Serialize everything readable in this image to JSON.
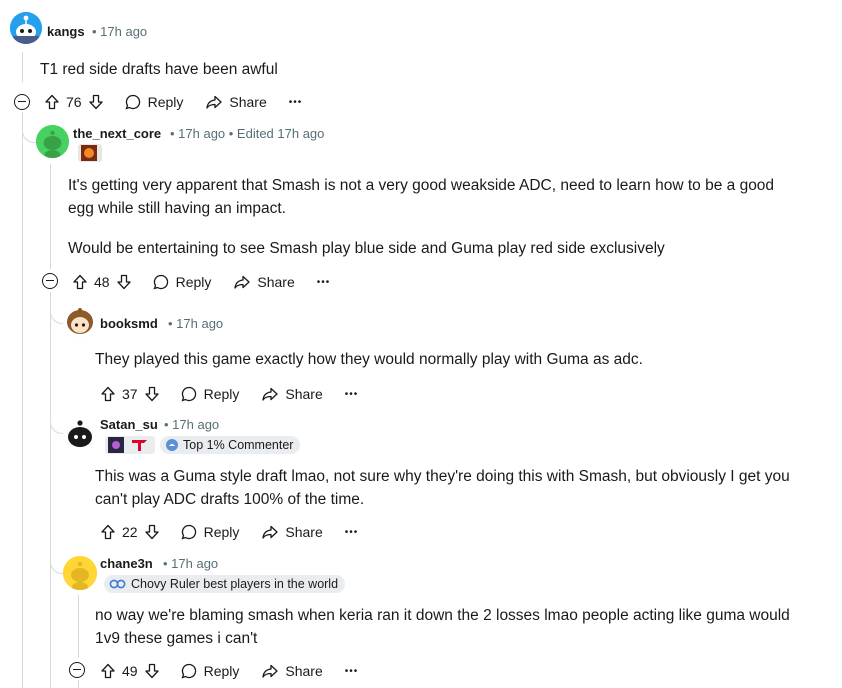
{
  "comments": [
    {
      "user": "kangs",
      "time": "• 17h ago",
      "body": [
        "T1 red side drafts have been awful"
      ],
      "votes": "76"
    },
    {
      "user": "the_next_core",
      "time": "• 17h ago • Edited 17h ago",
      "body": [
        "It's getting very apparent that Smash is not a very good weakside ADC, need to learn how to be a good",
        "egg while still having an impact.",
        "Would be entertaining to see Smash play blue side and Guma play red side exclusively"
      ],
      "votes": "48"
    },
    {
      "user": "booksmd",
      "time": "• 17h ago",
      "body": [
        "They played this game exactly how they would normally play with Guma as adc."
      ],
      "votes": "37"
    },
    {
      "user": "Satan_su",
      "time": "• 17h ago",
      "flair": "Top 1% Commenter",
      "body": [
        "This was a Guma style draft lmao, not sure why they're doing this with Smash, but obviously I get you",
        "can't play ADC drafts 100% of the time."
      ],
      "votes": "22"
    },
    {
      "user": "chane3n",
      "time": "• 17h ago",
      "flair": "Chovy Ruler best players in the world",
      "body": [
        "no way we're blaming smash when keria ran it down the 2 losses lmao people acting like guma would",
        "1v9 these games i can't"
      ],
      "votes": "49"
    }
  ],
  "actions": {
    "reply": "Reply",
    "share": "Share",
    "more": "•••"
  },
  "icons": {
    "upvote": "arrow-up-icon",
    "downvote": "arrow-down-icon",
    "reply": "speech-bubble-icon",
    "share": "share-arrow-icon",
    "collapse": "minus-circle-icon"
  },
  "colors": {
    "meta": "#576f76",
    "flair_bg": "#eaedef",
    "line": "#d7dadc"
  }
}
